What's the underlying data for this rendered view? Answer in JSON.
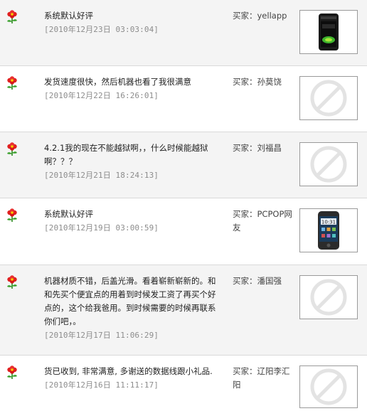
{
  "buyer_prefix": "买家：",
  "reviews": [
    {
      "comment": "系统默认好评",
      "date": "[2010年12月23日  03:03:04]",
      "buyer": "yellapp",
      "image": "nokia-phone-photo"
    },
    {
      "comment": "发货速度很快，然后机器也看了我很满意",
      "date": "[2010年12月22日  16:26:01]",
      "buyer": "孙莫饶",
      "image": "no-image-placeholder-icon"
    },
    {
      "comment": "4.2.1我的现在不能越狱啊，，什么时候能越狱啊？？？",
      "date": "[2010年12月21日  18:24:13]",
      "buyer": "刘福昌",
      "image": "no-image-placeholder-icon"
    },
    {
      "comment": "系统默认好评",
      "date": "[2010年12月19日  03:00:59]",
      "buyer": "PCPOP网友",
      "image": "htc-phone-photo"
    },
    {
      "comment": "机器材质不错，后盖光滑。看着崭新崭新的。和和先买个便宜点的用着到时候发工资了再买个好点的，这个给我爸用。到时候需要的时候再联系你们吧，。",
      "date": "[2010年12月17日  11:06:29]",
      "buyer": "潘国强",
      "image": "no-image-placeholder-icon"
    },
    {
      "comment": "货已收到, 非常满意, 多谢送的数据线跟小礼品.",
      "date": "[2010年12月16日  11:11:17]",
      "buyer": "辽阳李汇阳",
      "image": "no-image-placeholder-icon"
    }
  ]
}
